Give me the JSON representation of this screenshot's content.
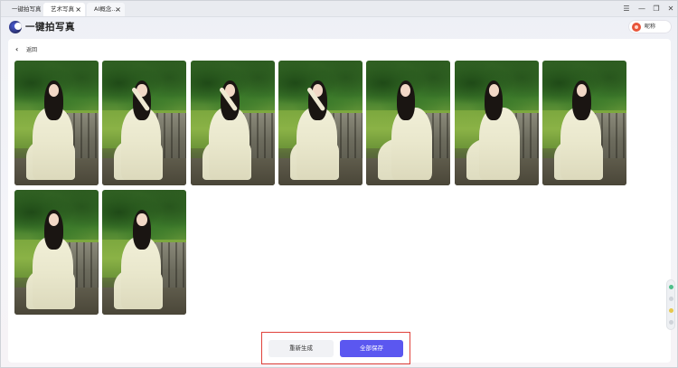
{
  "tabs": [
    {
      "label": "一键拍写真",
      "active": false,
      "closable": false
    },
    {
      "label": "艺术写真",
      "active": true,
      "closable": true
    },
    {
      "label": "AI概念...",
      "active": false,
      "closable": true
    }
  ],
  "tab_close_glyph": "×",
  "window_controls": {
    "menu": "☰",
    "minimize": "—",
    "restore": "❐",
    "close": "✕"
  },
  "header": {
    "app_title": "一键拍写真",
    "user_name": "昵称"
  },
  "back": {
    "chevron": "‹",
    "label": "返回"
  },
  "gallery": {
    "photos": [
      {
        "pose": "seated-on-bench"
      },
      {
        "pose": "arm-raised-with-fan"
      },
      {
        "pose": "arm-raised-with-fan"
      },
      {
        "pose": "hand-on-head"
      },
      {
        "pose": "seated-leaning"
      },
      {
        "pose": "seated-leaning"
      },
      {
        "pose": "seated-on-bench"
      },
      {
        "pose": "seated-on-bench"
      },
      {
        "pose": "seated-on-bench"
      }
    ]
  },
  "actions": {
    "regenerate_label": "重新生成",
    "save_all_label": "全部保存"
  },
  "colors": {
    "primary": "#5b57f0",
    "highlight_border": "#e0413a",
    "avatar": "#e8553a"
  },
  "icons": {
    "back": "chevron-left-icon",
    "menu": "menu-icon",
    "minimize": "minimize-icon",
    "restore": "restore-icon",
    "close": "close-icon"
  }
}
